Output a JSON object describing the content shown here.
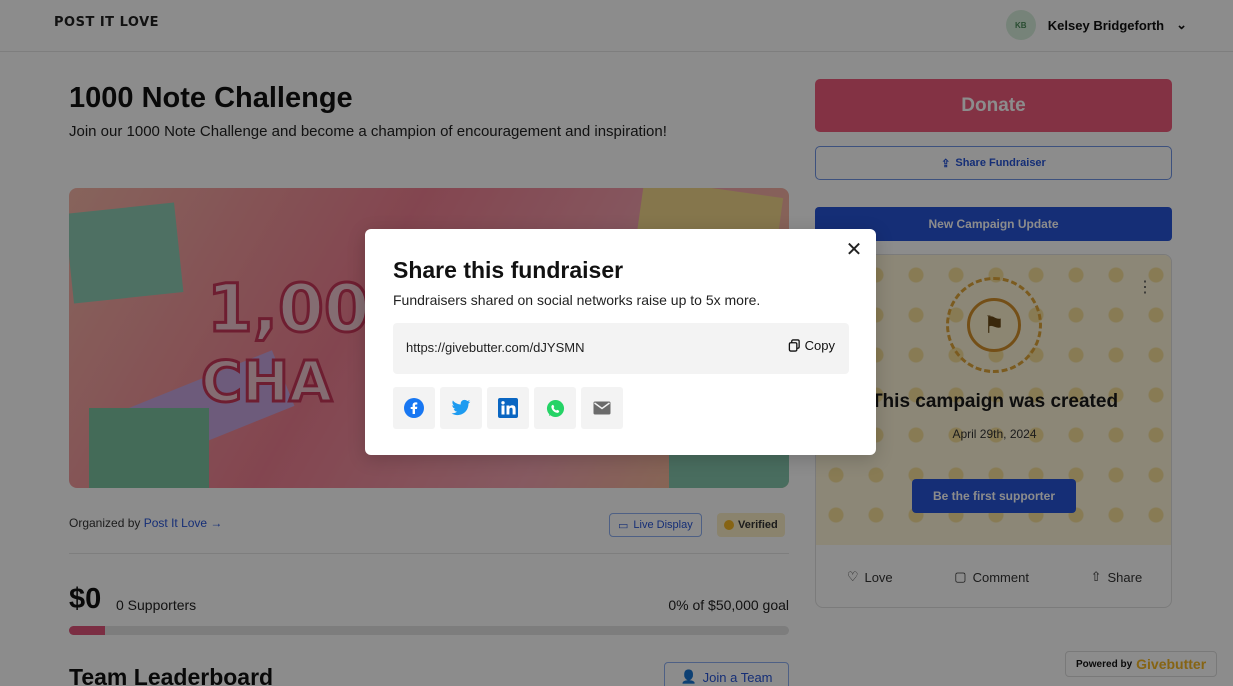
{
  "header": {
    "logo": "POST IT LOVE",
    "user_initials": "KB",
    "user_name": "Kelsey Bridgeforth"
  },
  "campaign": {
    "title": "1000 Note Challenge",
    "subtitle": "Join our 1000 Note Challenge and become a champion of encouragement and inspiration!",
    "hero_line1": "1,00",
    "hero_line2": "CHA",
    "organized_prefix": "Organized by",
    "organizer": "Post It Love →",
    "live_display": "Live Display",
    "verified": "Verified",
    "raised": "$0",
    "supporters": "0 Supporters",
    "goal_text": "0% of $50,000 goal",
    "progress_fraction": 0.05,
    "leaderboard_title": "Team Leaderboard",
    "join_team": "Join a Team"
  },
  "sidebar": {
    "donate": "Donate",
    "share_fundraiser": "Share Fundraiser",
    "new_update": "New Campaign Update",
    "card_title": "This campaign was created",
    "card_date": "April 29th, 2024",
    "first_supporter": "Be the first supporter",
    "love": "Love",
    "comment": "Comment",
    "share": "Share",
    "powered_prefix": "Powered by",
    "powered_brand": "Givebutter"
  },
  "modal": {
    "title": "Share this fundraiser",
    "subtitle": "Fundraisers shared on social networks raise up to 5x more.",
    "link": "https://givebutter.com/dJYSMN",
    "copy_label": "Copy",
    "social": [
      "facebook-icon",
      "twitter-icon",
      "linkedin-icon",
      "whatsapp-icon",
      "email-icon"
    ]
  },
  "colors": {
    "accent_blue": "#2755d8",
    "donate_pink": "#ef5b7c",
    "facebook": "#1877f2",
    "twitter": "#1d9bf0",
    "linkedin": "#0a66c2",
    "whatsapp": "#25d366",
    "email": "#6b6b6b"
  }
}
